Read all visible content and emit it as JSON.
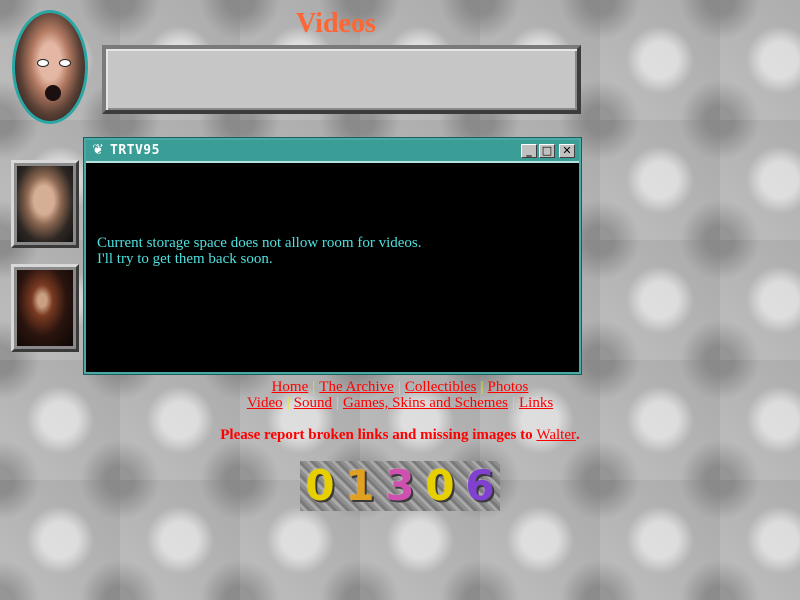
{
  "page": {
    "title": "Videos",
    "title_color": "#ff6633"
  },
  "window": {
    "title": "TRTV95",
    "icon": "heart-logo-icon",
    "buttons": {
      "minimize": "_",
      "maximize": "□",
      "close": "✕"
    },
    "message_line1": "Current storage space does not allow room for videos.",
    "message_line2": "I'll try to get them back soon."
  },
  "nav": {
    "row1": [
      "Home",
      "The Archive",
      "Collectibles",
      "Photos"
    ],
    "row2": [
      "Video",
      "Sound",
      "Games, Skins and Schemes",
      "Links"
    ],
    "separator": "|"
  },
  "report": {
    "text": "Please report broken links and missing images to ",
    "link": "Walter",
    "end": "."
  },
  "counter": {
    "digits": [
      "0",
      "1",
      "3",
      "0",
      "6"
    ],
    "colors": [
      "#e8d000",
      "#e0a020",
      "#d050b0",
      "#e8d000",
      "#8040d0"
    ]
  }
}
